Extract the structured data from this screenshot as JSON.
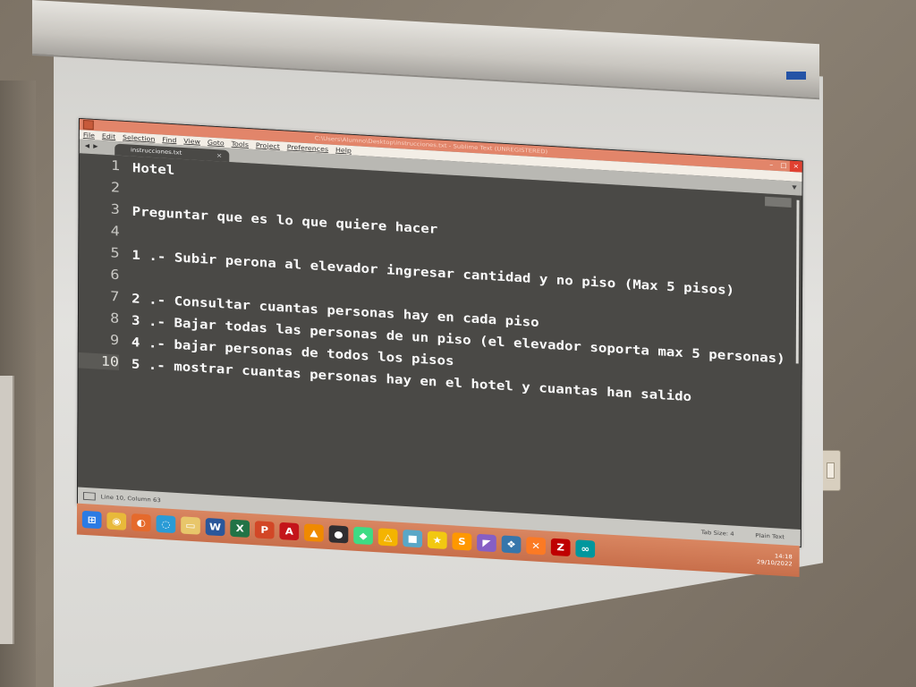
{
  "window": {
    "title": "C:\\Users\\Alumno\\Desktop\\instrucciones.txt - Sublime Text (UNREGISTERED)"
  },
  "menu": [
    "File",
    "Edit",
    "Selection",
    "Find",
    "View",
    "Goto",
    "Tools",
    "Project",
    "Preferences",
    "Help"
  ],
  "tab": {
    "label": "instrucciones.txt",
    "close": "×"
  },
  "editor": {
    "lines": [
      {
        "n": "1",
        "text": "Hotel"
      },
      {
        "n": "2",
        "text": ""
      },
      {
        "n": "3",
        "text": "Preguntar que es lo que quiere hacer"
      },
      {
        "n": "4",
        "text": ""
      },
      {
        "n": "5",
        "text": "1 .- Subir perona al elevador ingresar cantidad y no piso (Max 5 pisos)"
      },
      {
        "n": "6",
        "text": ""
      },
      {
        "n": "7",
        "text": "2 .- Consultar cuantas personas hay en cada piso"
      },
      {
        "n": "8",
        "text": "3 .- Bajar todas las personas de un piso (el elevador soporta max 5 personas)"
      },
      {
        "n": "9",
        "text": "4 .- bajar personas de todos los pisos"
      },
      {
        "n": "10",
        "text": "5 .- mostrar cuantas personas hay en el hotel y cuantas han salido"
      }
    ],
    "active_line": 10
  },
  "status": {
    "position": "Line 10, Column 63",
    "tab_size": "Tab Size: 4",
    "syntax": "Plain Text"
  },
  "taskbar": {
    "icons": [
      "windows-icon",
      "chrome-icon",
      "firefox-icon",
      "edge-icon",
      "file-explorer-icon",
      "word-icon",
      "excel-icon",
      "powerpoint-icon",
      "acrobat-icon",
      "vlc-icon",
      "obs-icon",
      "android-studio-icon",
      "drive-icon",
      "box-icon",
      "star-icon",
      "sublime-icon",
      "visual-studio-icon",
      "python-icon",
      "xampp-icon",
      "filezilla-icon",
      "arduino-icon"
    ],
    "time": "14:18",
    "date": "29/10/2022"
  },
  "colors": {
    "editor_bg": "#4a4946",
    "titlebar": "#e2856a",
    "taskbar": "#d98661",
    "text": "#fafafa"
  }
}
